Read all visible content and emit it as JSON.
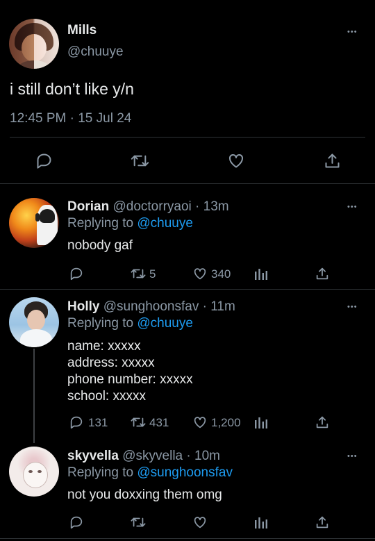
{
  "main_tweet": {
    "name": "Mills",
    "handle": "@chuuye",
    "text": "i still don’t like y/n",
    "time": "12:45 PM · 15 Jul 24",
    "more": "•••",
    "actions": [
      "reply-icon",
      "retweet-icon",
      "like-icon",
      "share-icon"
    ]
  },
  "replies": [
    {
      "name": "Dorian",
      "handle": "@doctorryaoi",
      "time": "· 13m",
      "replying_label": "Replying to",
      "replying_to": "@chuuye",
      "text": "nobody gaf",
      "retweets": "5",
      "likes": "340",
      "more": "•••"
    },
    {
      "name": "Holly",
      "handle": "@sunghoonsfav",
      "time": "· 11m",
      "replying_label": "Replying to",
      "replying_to": "@chuuye",
      "lines": [
        "name: xxxxx",
        "address: xxxxx",
        "phone number: xxxxx",
        "school: xxxxx"
      ],
      "replies": "131",
      "retweets": "431",
      "likes": "1,200",
      "more": "•••"
    },
    {
      "name": "skyvella",
      "handle": "@skyvella",
      "time": "· 10m",
      "replying_label": "Replying to",
      "replying_to": "@sunghoonsfav",
      "text": "not you doxxing them omg",
      "more": "•••"
    }
  ],
  "colors": {
    "background": "#000000",
    "text": "#e7e9ea",
    "muted": "#8b98a5",
    "link": "#1d9bf0",
    "divider": "#2f3336"
  }
}
